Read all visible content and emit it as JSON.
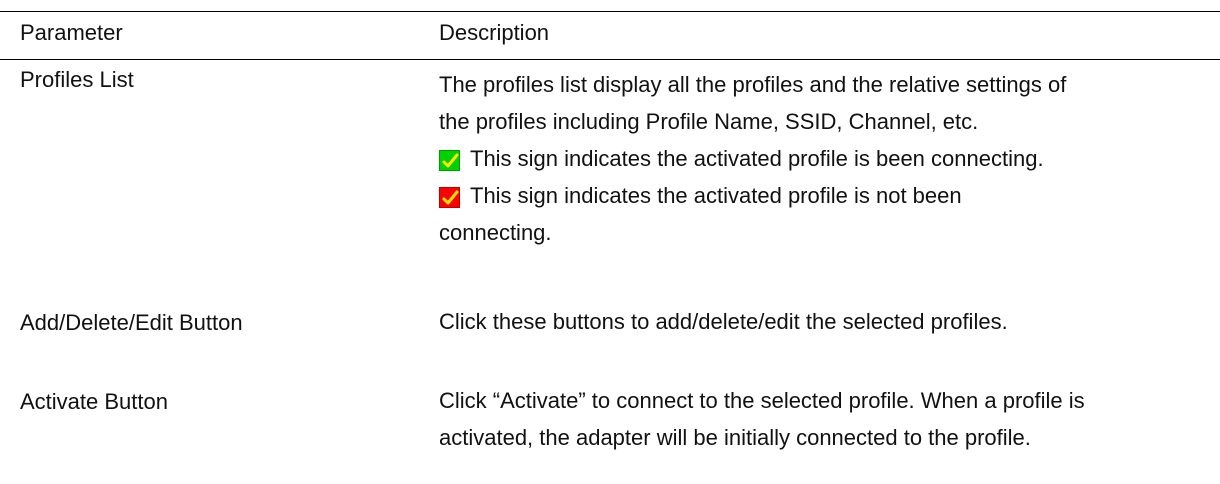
{
  "table": {
    "headers": [
      "Parameter",
      "Description"
    ],
    "rows": [
      {
        "parameter": "Profiles List",
        "description_lines": [
          "The profiles list display all the profiles and the relative settings of",
          "the profiles including Profile Name, SSID, Channel, etc.",
          "This sign indicates the activated profile is been connecting.",
          "This sign indicates the activated profile is not been",
          "connecting."
        ],
        "icons": {
          "connected": {
            "name": "green-check-icon",
            "color": "#00d200"
          },
          "not_connected": {
            "name": "red-check-icon",
            "color": "#ff0000"
          },
          "check_color": "#ffe600"
        }
      },
      {
        "parameter": "Add/Delete/Edit Button",
        "description_lines": [
          "Click these buttons to add/delete/edit the selected profiles."
        ]
      },
      {
        "parameter": "Activate Button",
        "description_lines": [
          "Click “Activate” to connect to the selected profile. When a profile is",
          "activated, the adapter will be initially connected to the profile."
        ]
      }
    ]
  }
}
